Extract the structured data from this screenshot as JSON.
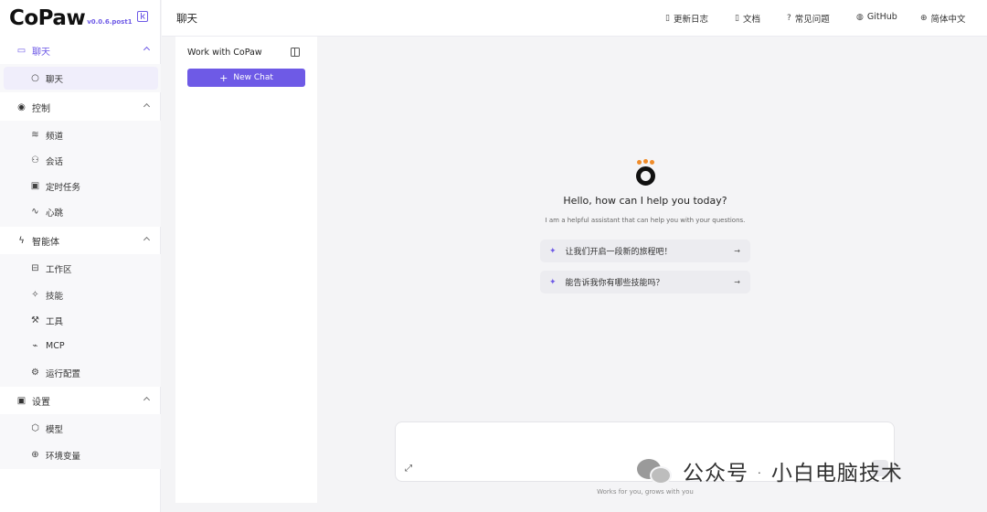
{
  "brand": {
    "logo": "CoPaw",
    "version": "v0.0.6.post1"
  },
  "header": {
    "title": "聊天",
    "nav": [
      {
        "label": "更新日志",
        "icon": "file-text-icon"
      },
      {
        "label": "文档",
        "icon": "file-icon"
      },
      {
        "label": "常见问题",
        "icon": "help-circle-icon"
      },
      {
        "label": "GitHub",
        "icon": "github-icon"
      },
      {
        "label": "简体中文",
        "icon": "globe-icon"
      }
    ]
  },
  "sidebar": {
    "groups": [
      {
        "label": "聊天",
        "icon": "message-icon",
        "active": true,
        "items": [
          {
            "label": "聊天",
            "icon": "chat-bubble-icon",
            "active": true
          }
        ]
      },
      {
        "label": "控制",
        "icon": "broadcast-icon",
        "items": [
          {
            "label": "频道",
            "icon": "wifi-icon"
          },
          {
            "label": "会话",
            "icon": "users-icon"
          },
          {
            "label": "定时任务",
            "icon": "calendar-clock-icon"
          },
          {
            "label": "心跳",
            "icon": "heartbeat-icon"
          }
        ]
      },
      {
        "label": "智能体",
        "icon": "zap-icon",
        "items": [
          {
            "label": "工作区",
            "icon": "briefcase-icon"
          },
          {
            "label": "技能",
            "icon": "sparkles-icon"
          },
          {
            "label": "工具",
            "icon": "wrench-icon"
          },
          {
            "label": "MCP",
            "icon": "plug-icon"
          },
          {
            "label": "运行配置",
            "icon": "gear-icon"
          }
        ]
      },
      {
        "label": "设置",
        "icon": "cpu-icon",
        "items": [
          {
            "label": "模型",
            "icon": "cube-icon"
          },
          {
            "label": "环境变量",
            "icon": "globe-icon"
          }
        ]
      }
    ]
  },
  "sessions": {
    "title": "Work with CoPaw",
    "new_chat_label": "New Chat"
  },
  "welcome": {
    "title": "Hello, how can I help you today?",
    "subtitle": "I am a helpful assistant that can help you with your questions.",
    "prompts": [
      "让我们开启一段新的旅程吧！",
      "能告诉我你有哪些技能吗？"
    ]
  },
  "composer": {
    "footer": "Works for you, grows with you"
  },
  "watermark": {
    "text": "公众号 · 小白电脑技术"
  },
  "colors": {
    "accent": "#6e5ae6",
    "logo_dots": "#f08c2a"
  }
}
